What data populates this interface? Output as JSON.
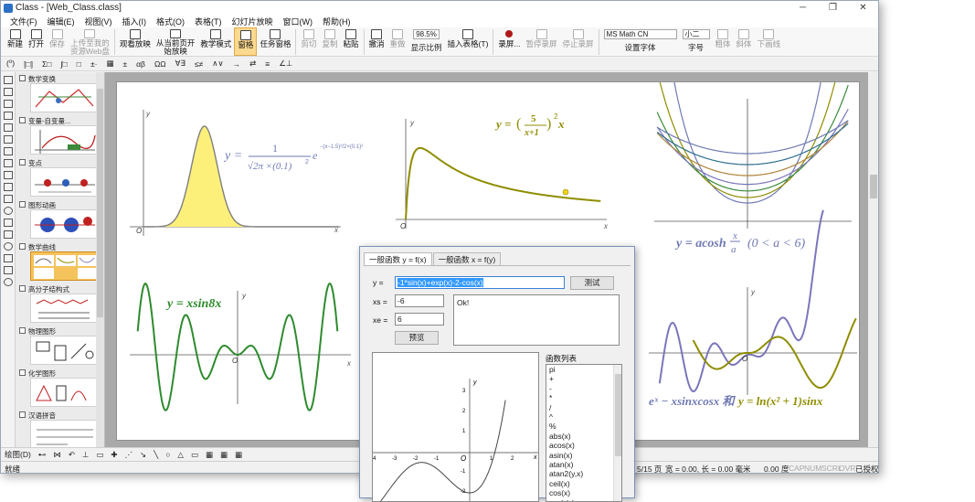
{
  "window": {
    "title": "Class - [Web_Class.class]",
    "min": "─",
    "max": "❐",
    "close": "✕"
  },
  "menu": [
    "文件(F)",
    "编辑(E)",
    "视图(V)",
    "插入(I)",
    "格式(O)",
    "表格(T)",
    "幻灯片放映",
    "窗口(W)",
    "帮助(H)"
  ],
  "toolbar": {
    "new": "新建",
    "open": "打开",
    "save": "保存",
    "upload_l1": "上传至我的",
    "upload_l2": "资源Web盘",
    "view_show": "观看放映",
    "from_current_l1": "从当前页开",
    "from_current_l2": "始放映",
    "teach_mode": "教学模式",
    "pane": "窗格",
    "task_pane": "任务窗格",
    "cut": "剪切",
    "copy": "复制",
    "paste": "粘贴",
    "undo": "撤消",
    "redo": "重做",
    "zoom_value": "98.5%",
    "show_ratio": "显示比例",
    "insert_table": "插入表格(T)",
    "record": "录屏...",
    "pause_record": "暂停录屏",
    "stop_record": "停止录屏",
    "font_name": "MS Math CN",
    "set_font": "设置字体",
    "font_size": "小二",
    "size_label": "字号",
    "bold": "粗体",
    "italic": "斜体",
    "underline": "下画线"
  },
  "formula_bar": [
    "(⁰)",
    "[□]",
    "Σ□",
    "∫□",
    "□",
    "±·",
    "▦",
    "±",
    "αβ",
    "ΩΩ",
    "∀∃",
    "≤≠",
    "∧∨",
    "→",
    "⇄",
    "≡",
    "∠⊥"
  ],
  "slides": [
    {
      "title": "数学变换"
    },
    {
      "title": "变量-自变量..."
    },
    {
      "title": "变点"
    },
    {
      "title": "图形动画"
    },
    {
      "title": "数学曲线"
    },
    {
      "title": "高分子结构式"
    },
    {
      "title": "物理图形"
    },
    {
      "title": "化学图形"
    },
    {
      "title": "汉语拼音"
    }
  ],
  "canvas": {
    "normal_formula": {
      "lhs": "y =",
      "num": "1",
      "den": "√2π ×(0.1)",
      "sup": "2",
      "exp": "−(x−1.5)²/2×(0.1)²",
      "e": "e"
    },
    "formula2": "y = (5/(x+1))² x",
    "formula2_parts": {
      "lhs": "y =",
      "num": "5",
      "den": "x+1",
      "pow": "2",
      "tail": "x"
    },
    "formula3": "y = acosh x/a  (0 < a < 6)",
    "formula3_parts": {
      "lhs": "y = acosh",
      "num": "x",
      "den": "a",
      "range": "(0 < a < 6)"
    },
    "formula4": "y = xsin8x",
    "formula5_parts": {
      "left": "eˣ − xsinxcosx 和",
      "right": "y = ln(x² + 1)sinx"
    },
    "axis_x": "x",
    "axis_y": "y",
    "origin": "O"
  },
  "drawbar": [
    "绘图(D)",
    "⊷",
    "⋈",
    "↶",
    "⊥",
    "▭",
    "✚",
    "⋰",
    "↘",
    "╲",
    "○",
    "△",
    "▭",
    "▦",
    "▦",
    "▦"
  ],
  "status": {
    "ready": "就绪",
    "page": "5/15 页",
    "size": "宽 = 0.00, 长 = 0.00 毫米",
    "degree": "0.00 度",
    "cap": "CAP",
    "num": "NUM",
    "scrl": "SCRL",
    "ovr": "OVR",
    "auth": "已授权"
  },
  "dialog": {
    "tab1": "一般函数 y = f(x)",
    "tab2": "一般函数 x = f(y)",
    "y_label": "y =",
    "y_value": "-1*sin(x)+exp(x)-2-cos(x)",
    "xs_label": "xs =",
    "xs_value": "-6",
    "xe_label": "xe =",
    "xe_value": "6",
    "test_button": "测试",
    "preview_button": "预览",
    "result": "Ok!",
    "func_list_label": "函数列表",
    "functions": [
      "pi",
      "+",
      "-",
      "*",
      "/",
      "^",
      "%",
      "abs(x)",
      "acos(x)",
      "asin(x)",
      "atan(x)",
      "atan2(y,x)",
      "ceil(x)",
      "cos(x)",
      "cosh(x)"
    ],
    "preview": {
      "x_label": "x",
      "y_label": "y",
      "origin": "O",
      "x_ticks": [
        "-4",
        "-3",
        "-2",
        "-1",
        "1",
        "2"
      ],
      "y_ticks": [
        "3",
        "2",
        "1",
        "-1",
        "-2"
      ]
    }
  },
  "colors": {
    "accent": "#f5c35c",
    "pane_active": "#fbd98f",
    "curve_olive": "#8f8d00",
    "curve_green": "#2e8b2e",
    "curve_purple": "#7b76bb",
    "formula_blue": "#6f7ab3"
  }
}
